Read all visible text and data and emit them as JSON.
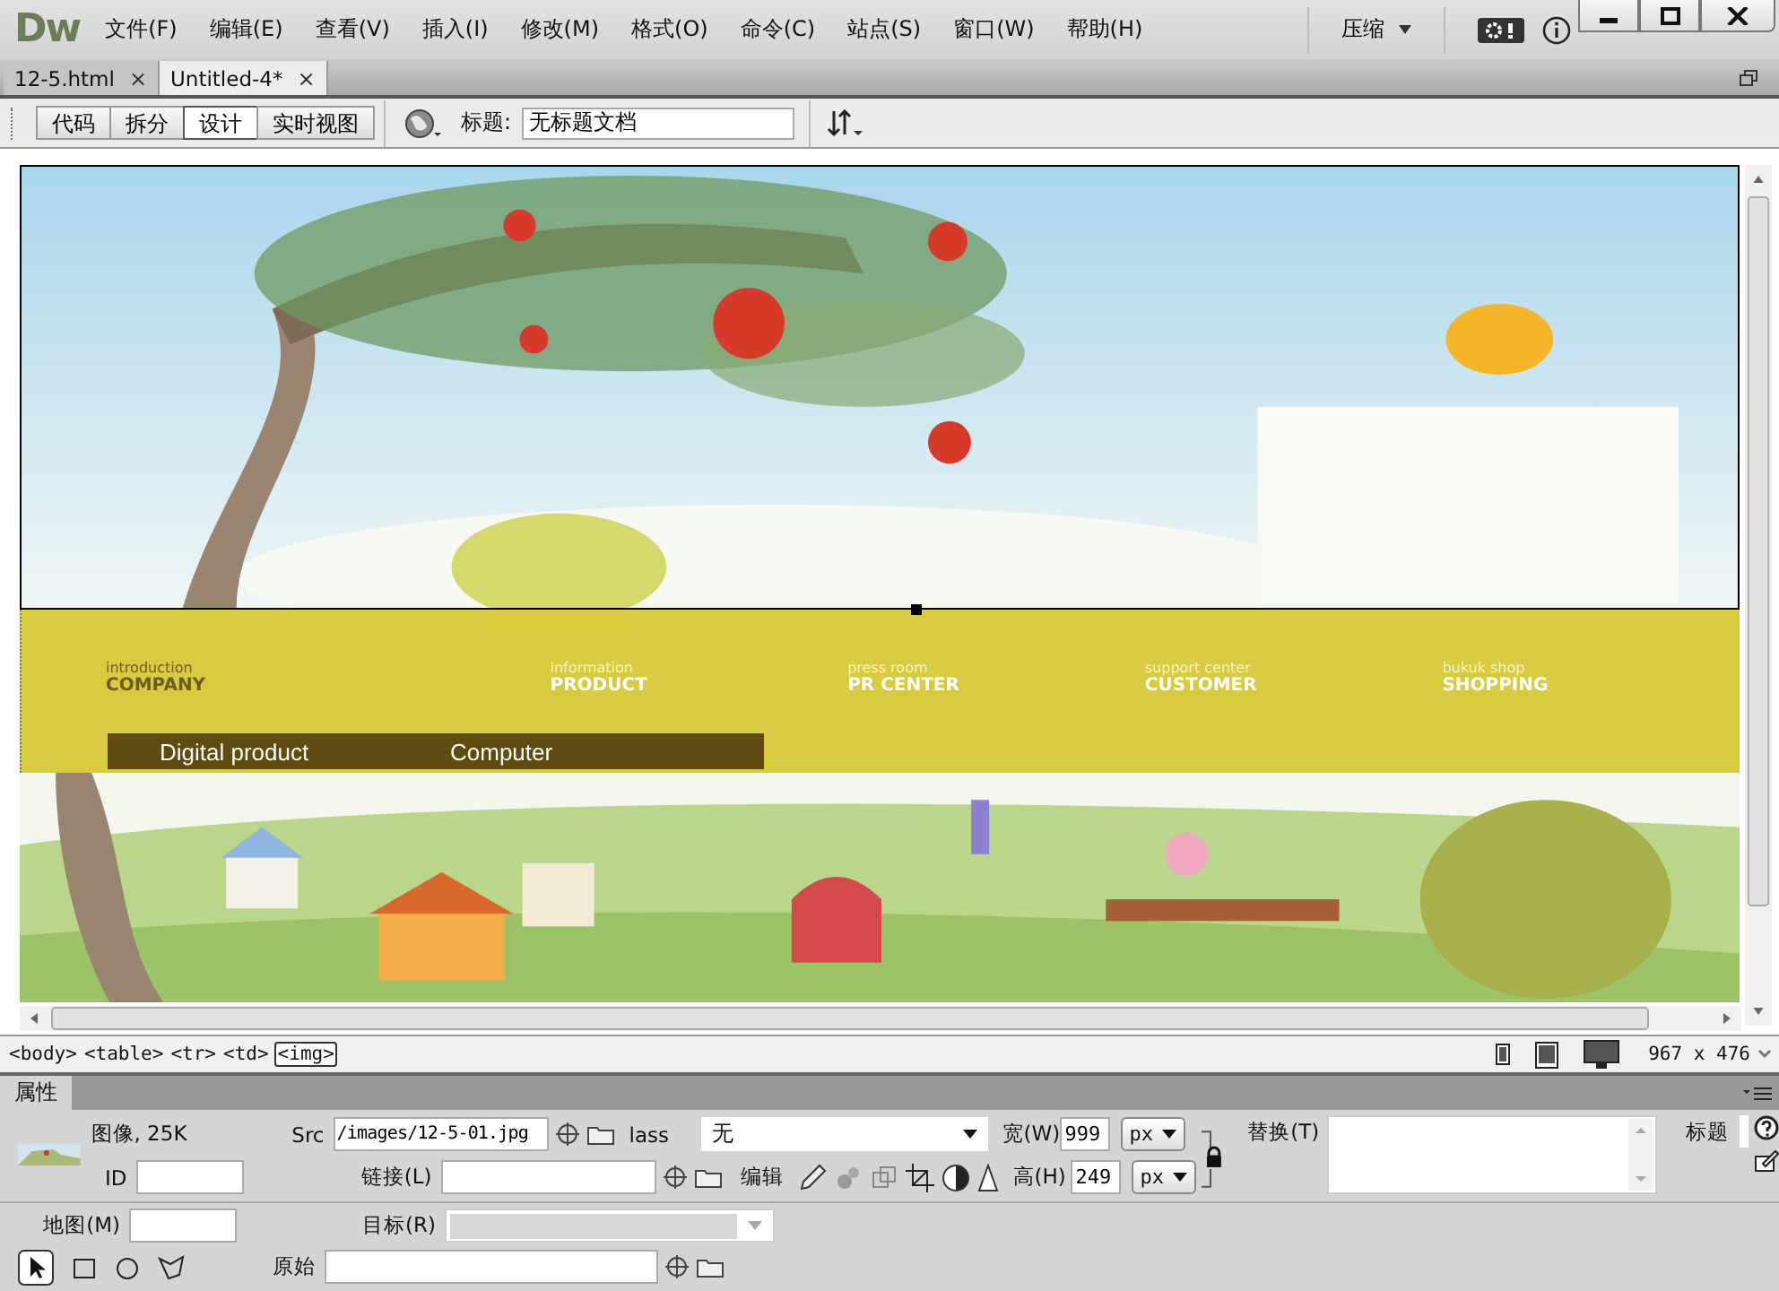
{
  "app": {
    "logo": "Dw"
  },
  "menu": [
    "文件(F)",
    "编辑(E)",
    "查看(V)",
    "插入(I)",
    "修改(M)",
    "格式(O)",
    "命令(C)",
    "站点(S)",
    "窗口(W)",
    "帮助(H)"
  ],
  "workspace": {
    "label": "压缩"
  },
  "tabs": [
    {
      "label": "12-5.html",
      "close": "×",
      "selected": false
    },
    {
      "label": "Untitled-4*",
      "close": "×",
      "selected": true
    }
  ],
  "view_buttons": [
    {
      "label": "代码",
      "selected": false
    },
    {
      "label": "拆分",
      "selected": false
    },
    {
      "label": "设计",
      "selected": true
    },
    {
      "label": "实时视图",
      "selected": false
    }
  ],
  "title_field": {
    "label": "标题:",
    "value": "无标题文档"
  },
  "design": {
    "nav": [
      {
        "small": "introduction",
        "label": "COMPANY"
      },
      {
        "small": "information",
        "label": "PRODUCT"
      },
      {
        "small": "press room",
        "label": "PR CENTER"
      },
      {
        "small": "support center",
        "label": "CUSTOMER"
      },
      {
        "small": "bukuk shop",
        "label": "SHOPPING"
      }
    ],
    "submenu": [
      "Digital product",
      "Computer"
    ]
  },
  "tag_selector": [
    {
      "label": "<body>",
      "selected": false
    },
    {
      "label": "<table>",
      "selected": false
    },
    {
      "label": "<tr>",
      "selected": false
    },
    {
      "label": "<td>",
      "selected": false
    },
    {
      "label": "<img>",
      "selected": true
    }
  ],
  "window_size": "967 x 476",
  "properties": {
    "tab": "属性",
    "type": "图像, 25K",
    "src": {
      "label": "Src",
      "value": "/images/12-5-01.jpg"
    },
    "class": {
      "label": "lass",
      "value": "无"
    },
    "width": {
      "label": "宽(W)",
      "value": "999",
      "unit": "px"
    },
    "height": {
      "label": "高(H)",
      "value": "249",
      "unit": "px"
    },
    "alt": {
      "label": "替换(T)"
    },
    "title": {
      "label": "标题"
    },
    "id": {
      "label": "ID"
    },
    "link": {
      "label": "链接(L)"
    },
    "edit": {
      "label": "编辑"
    },
    "map": {
      "label": "地图(M)"
    },
    "target": {
      "label": "目标(R)",
      "disabled": true
    },
    "original": {
      "label": "原始"
    }
  }
}
